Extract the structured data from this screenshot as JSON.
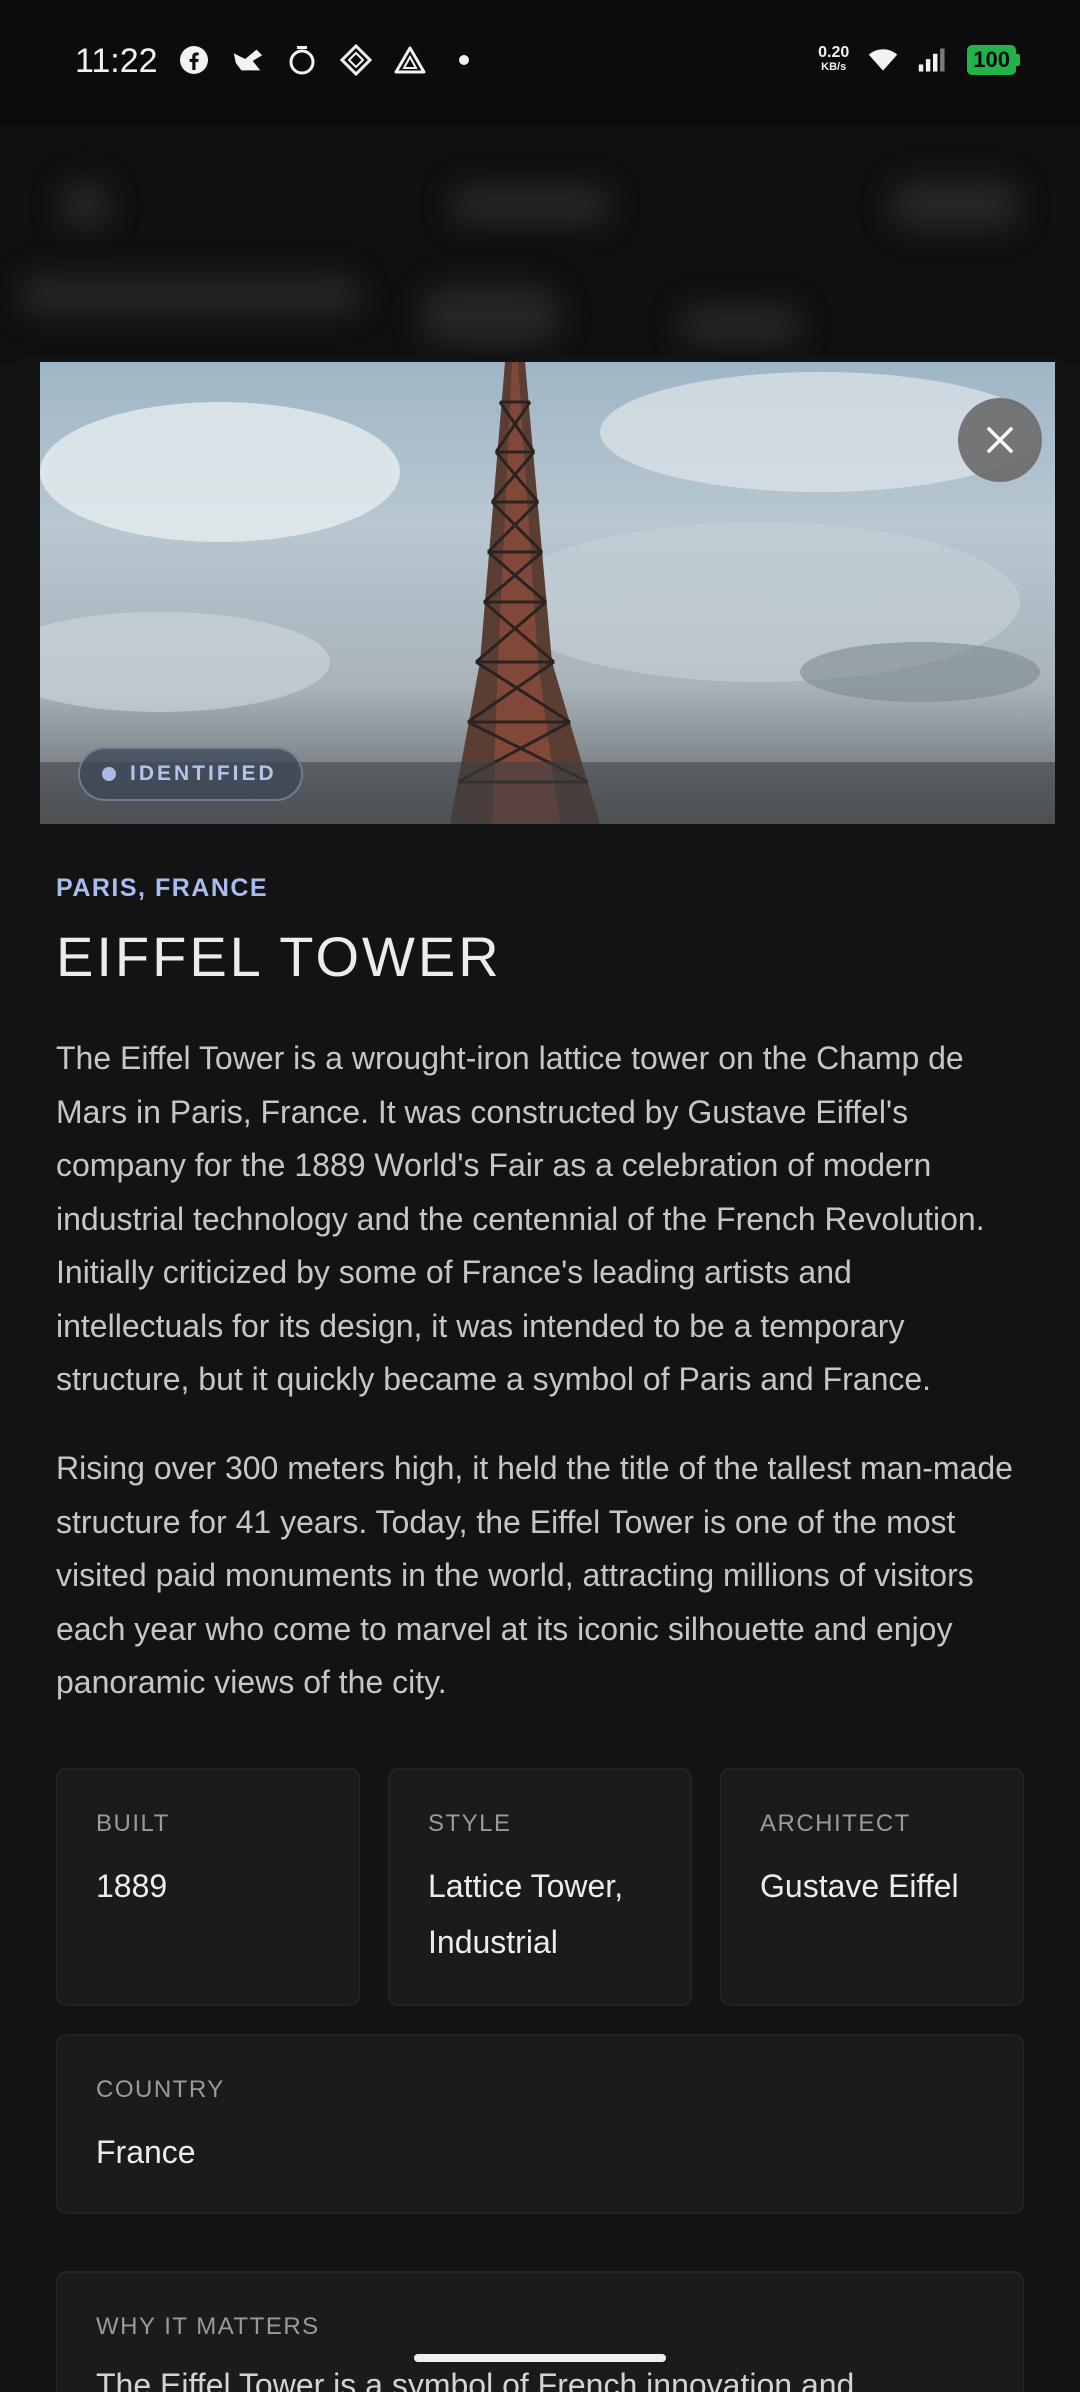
{
  "status_bar": {
    "time": "11:22",
    "icons": [
      "facebook-icon",
      "bird-app-icon",
      "timer-icon",
      "diamond-app-icon",
      "triangle-app-icon",
      "dot-icon"
    ],
    "net_speed_value": "0.20",
    "net_speed_unit": "KB/s",
    "battery": "100",
    "battery_color": "#21b24a"
  },
  "hero": {
    "badge": "IDENTIFIED",
    "close_icon": "close-icon"
  },
  "landmark": {
    "location": "PARIS, FRANCE",
    "title": "EIFFEL TOWER",
    "paragraphs": [
      "The Eiffel Tower is a wrought-iron lattice tower on the Champ de Mars in Paris, France. It was constructed by Gustave Eiffel's company for the 1889 World's Fair as a celebration of modern industrial technology and the centennial of the French Revolution. Initially criticized by some of France's leading artists and intellectuals for its design, it was intended to be a temporary structure, but it quickly became a symbol of Paris and France.",
      "Rising over 300 meters high, it held the title of the tallest man-made structure for 41 years. Today, the Eiffel Tower is one of the most visited paid monuments in the world, attracting millions of visitors each year who come to marvel at its iconic silhouette and enjoy panoramic views of the city."
    ]
  },
  "facts": {
    "built": {
      "label": "BUILT",
      "value": "1889"
    },
    "style": {
      "label": "STYLE",
      "value": "Lattice Tower, Industrial"
    },
    "architect": {
      "label": "ARCHITECT",
      "value": "Gustave Eiffel"
    },
    "country": {
      "label": "COUNTRY",
      "value": "France"
    }
  },
  "why": {
    "label": "WHY IT MATTERS",
    "text": "The Eiffel Tower is a symbol of French innovation and"
  },
  "colors": {
    "accent": "#a9bcf0",
    "background": "#131313",
    "card": "#1b1b1b"
  }
}
